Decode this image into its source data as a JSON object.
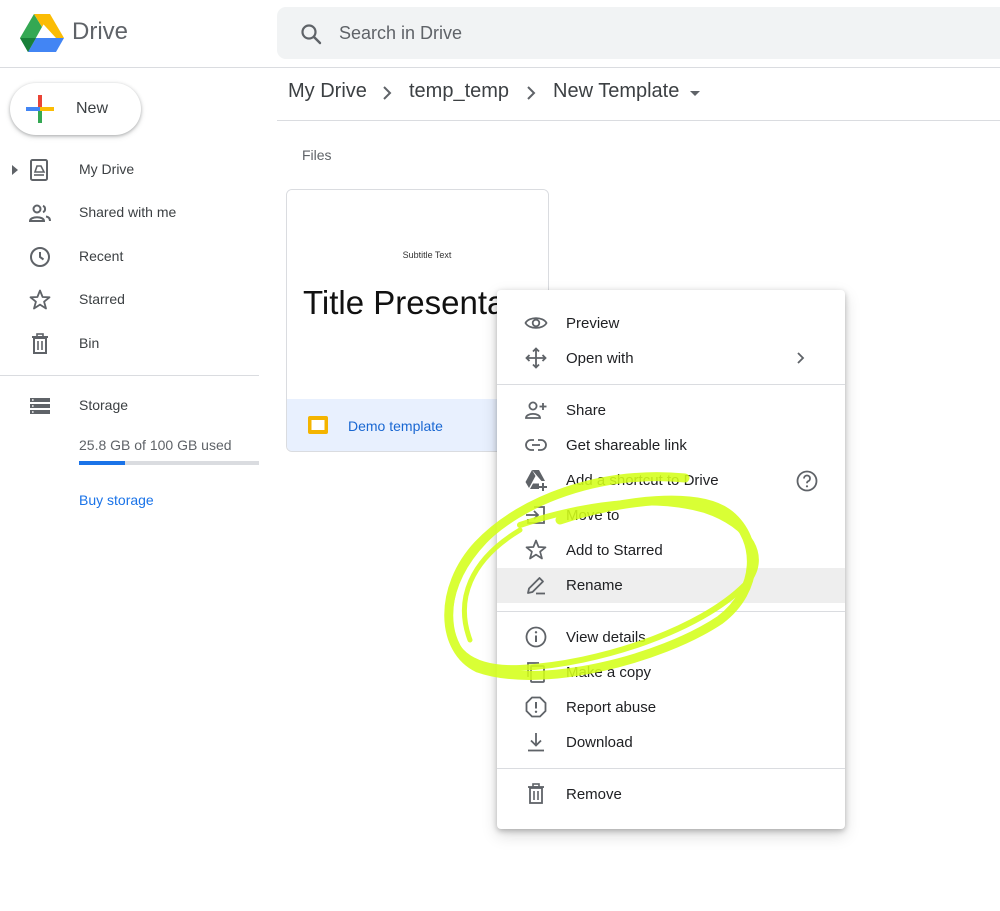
{
  "app": {
    "title": "Drive"
  },
  "search": {
    "placeholder": "Search in Drive"
  },
  "new_button": {
    "label": "New"
  },
  "sidebar": {
    "items": [
      {
        "label": "My Drive",
        "icon": "my-drive-icon"
      },
      {
        "label": "Shared with me",
        "icon": "shared-icon"
      },
      {
        "label": "Recent",
        "icon": "clock-icon"
      },
      {
        "label": "Starred",
        "icon": "star-icon"
      },
      {
        "label": "Bin",
        "icon": "trash-icon"
      }
    ],
    "storage": {
      "label": "Storage",
      "used_text": "25.8 GB of 100 GB used",
      "used_fraction": 0.258,
      "buy_label": "Buy storage"
    }
  },
  "breadcrumb": [
    "My Drive",
    "temp_temp",
    "New Template"
  ],
  "main": {
    "section_title": "Files",
    "file": {
      "name": "Demo template",
      "thumb_subtitle": "Subtitle Text",
      "thumb_title": "Title Presentation"
    }
  },
  "context_menu": {
    "items": [
      {
        "label": "Preview",
        "icon": "eye-icon"
      },
      {
        "label": "Open with",
        "icon": "move-icon"
      },
      {
        "label": "Share",
        "icon": "person-add-icon"
      },
      {
        "label": "Get shareable link",
        "icon": "link-icon"
      },
      {
        "label": "Add a shortcut to Drive",
        "icon": "drive-shortcut-icon"
      },
      {
        "label": "Move to",
        "icon": "move-to-icon"
      },
      {
        "label": "Add to Starred",
        "icon": "star-outline-icon"
      },
      {
        "label": "Rename",
        "icon": "pencil-icon",
        "highlighted": true
      },
      {
        "label": "View details",
        "icon": "info-icon"
      },
      {
        "label": "Make a copy",
        "icon": "copy-icon"
      },
      {
        "label": "Report abuse",
        "icon": "report-icon"
      },
      {
        "label": "Download",
        "icon": "download-icon"
      },
      {
        "label": "Remove",
        "icon": "trash-icon"
      }
    ]
  },
  "colors": {
    "accent": "#1a73e8",
    "highlight_marker": "#d4ff1a",
    "selected_file_bg": "#e8f0fe"
  }
}
